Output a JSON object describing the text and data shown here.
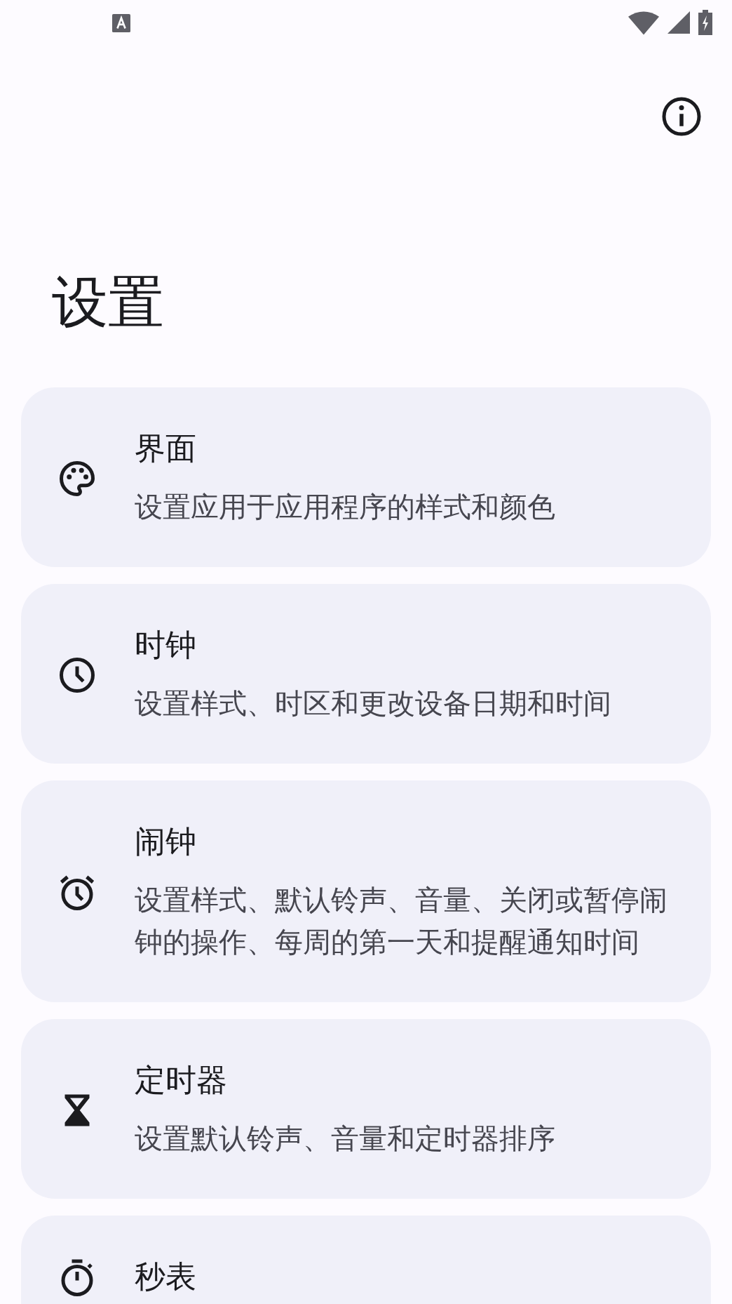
{
  "title": "设置",
  "cards": [
    {
      "kind": "palette",
      "title": "界面",
      "description": "设置应用于应用程序的样式和颜色"
    },
    {
      "kind": "clock",
      "title": "时钟",
      "description": "设置样式、时区和更改设备日期和时间"
    },
    {
      "kind": "alarm",
      "title": "闹钟",
      "description": "设置样式、默认铃声、音量、关闭或暂停闹钟的操作、每周的第一天和提醒通知时间"
    },
    {
      "kind": "hourglass",
      "title": "定时器",
      "description": "设置默认铃声、音量和定时器排序"
    },
    {
      "kind": "stopwatch",
      "title": "秒表"
    }
  ]
}
